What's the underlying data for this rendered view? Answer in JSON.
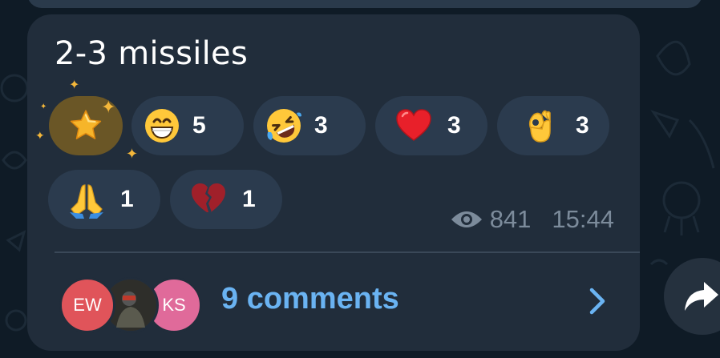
{
  "message": {
    "text": "2-3 missiles",
    "views": "841",
    "time": "15:44"
  },
  "reactions": [
    {
      "icon": "star-icon",
      "count": ""
    },
    {
      "icon": "grinning-face-icon",
      "count": "5"
    },
    {
      "icon": "rolling-laughing-face-icon",
      "count": "3"
    },
    {
      "icon": "red-heart-icon",
      "count": "3"
    },
    {
      "icon": "ok-hand-icon",
      "count": "3"
    },
    {
      "icon": "folded-hands-icon",
      "count": "1"
    },
    {
      "icon": "broken-heart-icon",
      "count": "1"
    }
  ],
  "comments": {
    "label": "9 comments",
    "avatars": [
      {
        "initials": "EW",
        "color": "#e0545a"
      },
      {
        "initials": "",
        "color": "#3a3a36"
      },
      {
        "initials": "KS",
        "color": "#e06a9a"
      }
    ]
  },
  "colors": {
    "bubble": "#212d3b",
    "reaction_chip": "#2b3b4e",
    "accent_link": "#6ab3f2",
    "star_chip": "#6a5626"
  }
}
